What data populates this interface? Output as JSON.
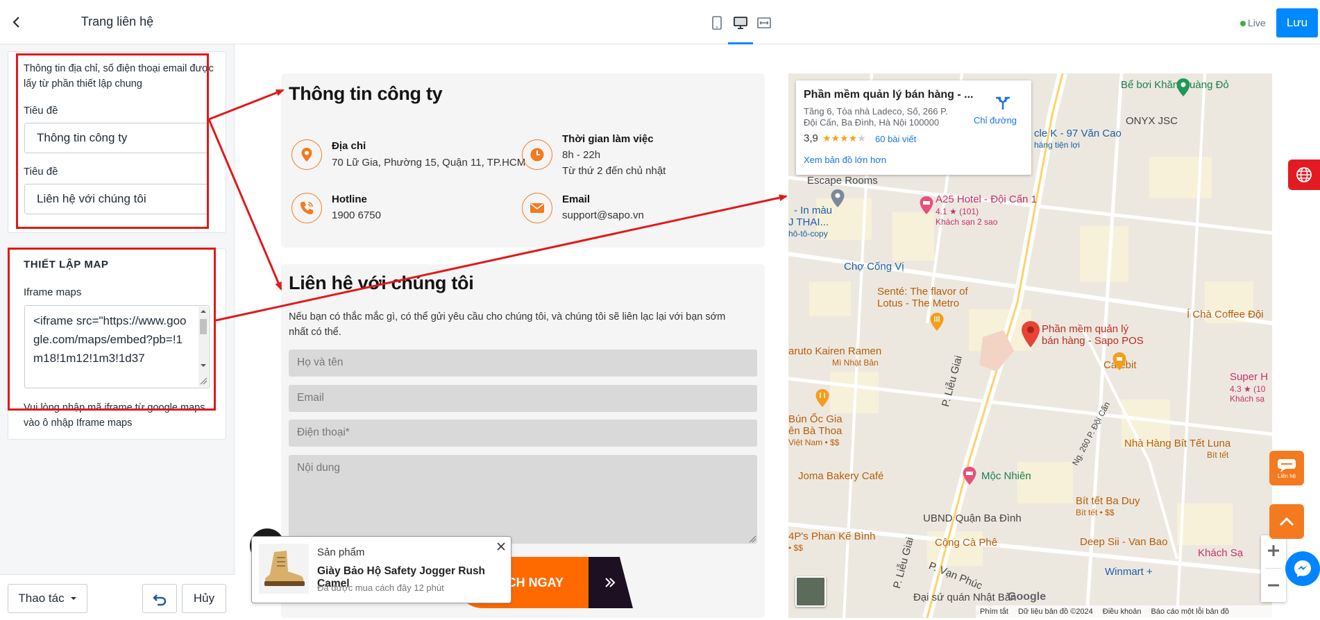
{
  "editor": {
    "title": "Trang liên hệ",
    "card1": {
      "note": "Thông tin địa chỉ, số điện thoại email được lấy từ phần thiết lập chung",
      "label1": "Tiêu đề",
      "value1": "Thông tin công ty",
      "label2": "Tiêu đề",
      "value2": "Liên hệ với chúng tôi"
    },
    "card2": {
      "section": "THIẾT LẬP MAP",
      "label": "Iframe maps",
      "value": "<iframe src=\"https://www.google.com/maps/embed?pb=!1m18!1m12!1m3!1d37",
      "help": "Vui lòng nhập mã iframe từ google maps vào ô nhập Iframe maps"
    },
    "footer": {
      "actions": "Thao tác",
      "cancel": "Hủy"
    }
  },
  "topbar": {
    "live": "Live",
    "save": "Lưu"
  },
  "preview": {
    "info": {
      "title": "Thông tin công ty",
      "address_label": "Địa chỉ",
      "address": "70 Lữ Gia, Phường 15, Quận 11, TP.HCM",
      "hours_label": "Thời gian làm việc",
      "hours_1": "8h - 22h",
      "hours_2": "Từ thứ 2 đến chủ nhật",
      "hotline_label": "Hotline",
      "hotline": "1900 6750",
      "email_label": "Email",
      "email": "support@sapo.vn"
    },
    "contact": {
      "title": "Liên hệ với chúng tôi",
      "description": "Nếu bạn có thắc mắc gì, có thể gửi yêu cầu cho chúng tôi, và chúng tôi sẽ liên lạc lại với bạn sớm nhất có thể.",
      "name_ph": "Họ và tên",
      "email_ph": "Email",
      "phone_ph": "Điện thoại*",
      "content_ph": "Nội dung",
      "submit": "LỊCH NGAY"
    },
    "popup": {
      "kicker": "Sản phẩm",
      "product": "Giày Bảo Hộ Safety Jogger Rush Camel",
      "time": "Đã được mua cách đây 12 phút"
    }
  },
  "map": {
    "card": {
      "name": "Phần mềm quản lý bán hàng - ...",
      "address_1": "Tầng 6, Tòa nhà Ladeco, Số, 266 P.",
      "address_2": "Đội Cấn, Ba Đình, Hà Nội 100000",
      "rating": "3,9",
      "reviews": "60 bài viết",
      "directions": "Chỉ đường",
      "larger": "Xem bản đồ lớn hơn"
    },
    "labels": {
      "escape": "Escape Rooms",
      "a25": "A25 Hotel - Đội Cấn 1",
      "a25_rating": "4.1 ★ (101)",
      "a25_type": "Khách sạn 2 sao",
      "inmau": "- In màu",
      "jthai": "J THAI...",
      "photocopy": "hô-tô-copy",
      "chocongvi": "Chợ Cống Vị",
      "sente1": "Senté: The flavor of",
      "sente2": "Lotus - The Metro",
      "sapo1": "Phần mềm quản lý",
      "sapo2": "bán hàng - Sapo POS",
      "kairen": "aruto Kairen Ramen",
      "minhatban": "Mì Nhật Bản",
      "cafebit": "Cafebit",
      "boi": "Bể bơi Khăn Quàng Đỏ",
      "onyx": "ONYX JSC",
      "circlek": "cle K - 97 Văn Cao",
      "hangtienloi": "hàng tiện lợi",
      "ichacoffee": "Í Chà Coffee Đội",
      "superh": "Super H",
      "superh_rating": "4.3 ★ (10",
      "superh_type": "Khách sạ",
      "bunoc1": "Bún Ốc Gia",
      "bunoc2": "ên Bà Thoa",
      "bunoc3": "Việt Nam • $$",
      "nhahang1": "Nhà Hàng Bít Tết Luna",
      "nhahang2": "Bít tết",
      "joma": "Joma Bakery Café",
      "mocnhien": "Mộc Nhiên",
      "bitset1": "Bít tết Ba Duy",
      "bitset2": "Bít tết • $$",
      "phanke1": "4P's Phan Kế Bình",
      "phanke2": "• $$",
      "ubnd": "UBND Quận Ba Đình",
      "congcaphe": "Cộng Cà Phê",
      "deepsii": "Deep Sii - Van Bao",
      "khachsa": "Khách Sạ",
      "winmart": "Winmart +",
      "daisu": "Đại sứ quán Nhật Bản",
      "lieugiai1": "P. Liễu Giai",
      "lieugiai2": "P. Liễu Giai",
      "vanphuc": "P. Vạn Phúc",
      "doican": "Ng. 260 P. Đội Cấn",
      "google": "Google",
      "footer_1": "Phím tắt",
      "footer_2": "Dữ liệu bản đồ ©2024",
      "footer_3": "Điều khoản",
      "footer_4": "Báo cáo một lỗi bản đồ"
    }
  },
  "floating": {
    "chat": "Liên hệ"
  },
  "colors": {
    "accent": "#0088ff",
    "orange": "#f47a1f",
    "highlight": "#e0191a"
  }
}
